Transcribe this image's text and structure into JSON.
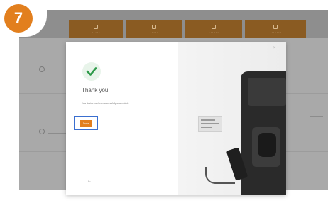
{
  "step": {
    "number": "7",
    "color": "#e27f1e"
  },
  "nav": {
    "tabs": [
      {
        "label": "· · · · ·"
      },
      {
        "label": "· · · · ·"
      },
      {
        "label": "· · · · · ·"
      },
      {
        "label": "· · · · · · ·"
      }
    ]
  },
  "modal": {
    "title": "Thank you!",
    "message": "Your device has been successfully assembled.",
    "done_label": "Done",
    "back_label": "←",
    "close_label": "×",
    "accent_color": "#e27f1e",
    "focus_color": "#3a6fd0",
    "check_color": "#2e9a4a"
  },
  "icons": [
    "check-icon",
    "close-icon",
    "back-arrow-icon"
  ]
}
